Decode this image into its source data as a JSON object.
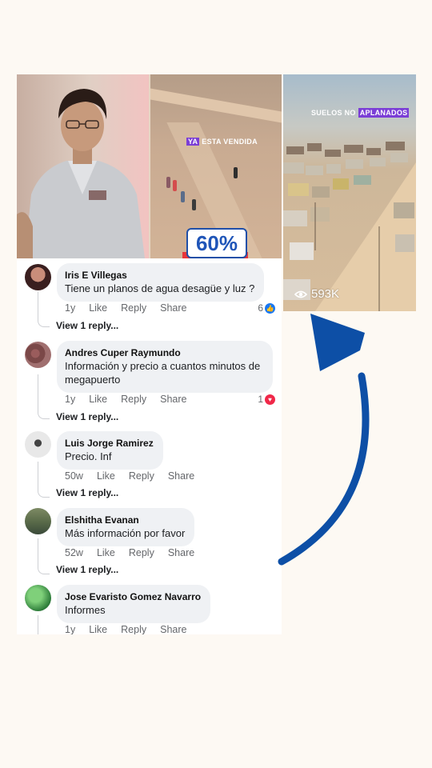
{
  "video_left": {
    "sold_badge_highlight": "YA",
    "sold_badge_rest": "ESTA VENDIDA",
    "percent": "60%"
  },
  "video_right": {
    "caption_rest": "SUELOS NO",
    "caption_highlight": "APLANADOS",
    "views": "593K"
  },
  "comments": [
    {
      "author": "Iris E Villegas",
      "text": "Tiene un planos de agua desagüe y luz ?",
      "time": "1y",
      "like": "Like",
      "reply": "Reply",
      "share": "Share",
      "reaction_count": "6",
      "reaction_type": "like",
      "view_replies": "View 1 reply..."
    },
    {
      "author": "Andres Cuper Raymundo",
      "text": "Información y precio a cuantos  minutos de megapuerto",
      "time": "1y",
      "like": "Like",
      "reply": "Reply",
      "share": "Share",
      "reaction_count": "1",
      "reaction_type": "love",
      "view_replies": "View 1 reply..."
    },
    {
      "author": "Luis Jorge Ramirez",
      "text": "Precio. Inf",
      "time": "50w",
      "like": "Like",
      "reply": "Reply",
      "share": "Share",
      "view_replies": "View 1 reply..."
    },
    {
      "author": "Elshitha Evanan",
      "text": "Más información por favor",
      "time": "52w",
      "like": "Like",
      "reply": "Reply",
      "share": "Share",
      "view_replies": "View 1 reply..."
    },
    {
      "author": "Jose Evaristo Gomez Navarro",
      "text": "Informes",
      "time": "1y",
      "like": "Like",
      "reply": "Reply",
      "share": "Share"
    }
  ],
  "colors": {
    "arrow": "#0d4fa6",
    "like_badge": "#1877f2",
    "love_badge": "#f02849",
    "highlight": "#7b3ed6"
  }
}
